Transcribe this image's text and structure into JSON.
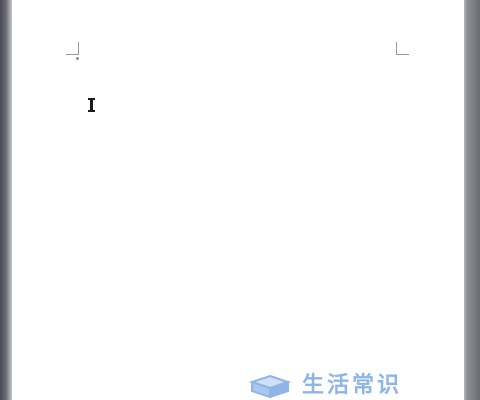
{
  "document": {
    "cursor": "text-insertion-cursor"
  },
  "watermark": {
    "icon": "cube-icon",
    "text": "生活常识",
    "color": "#8fb4e8"
  }
}
